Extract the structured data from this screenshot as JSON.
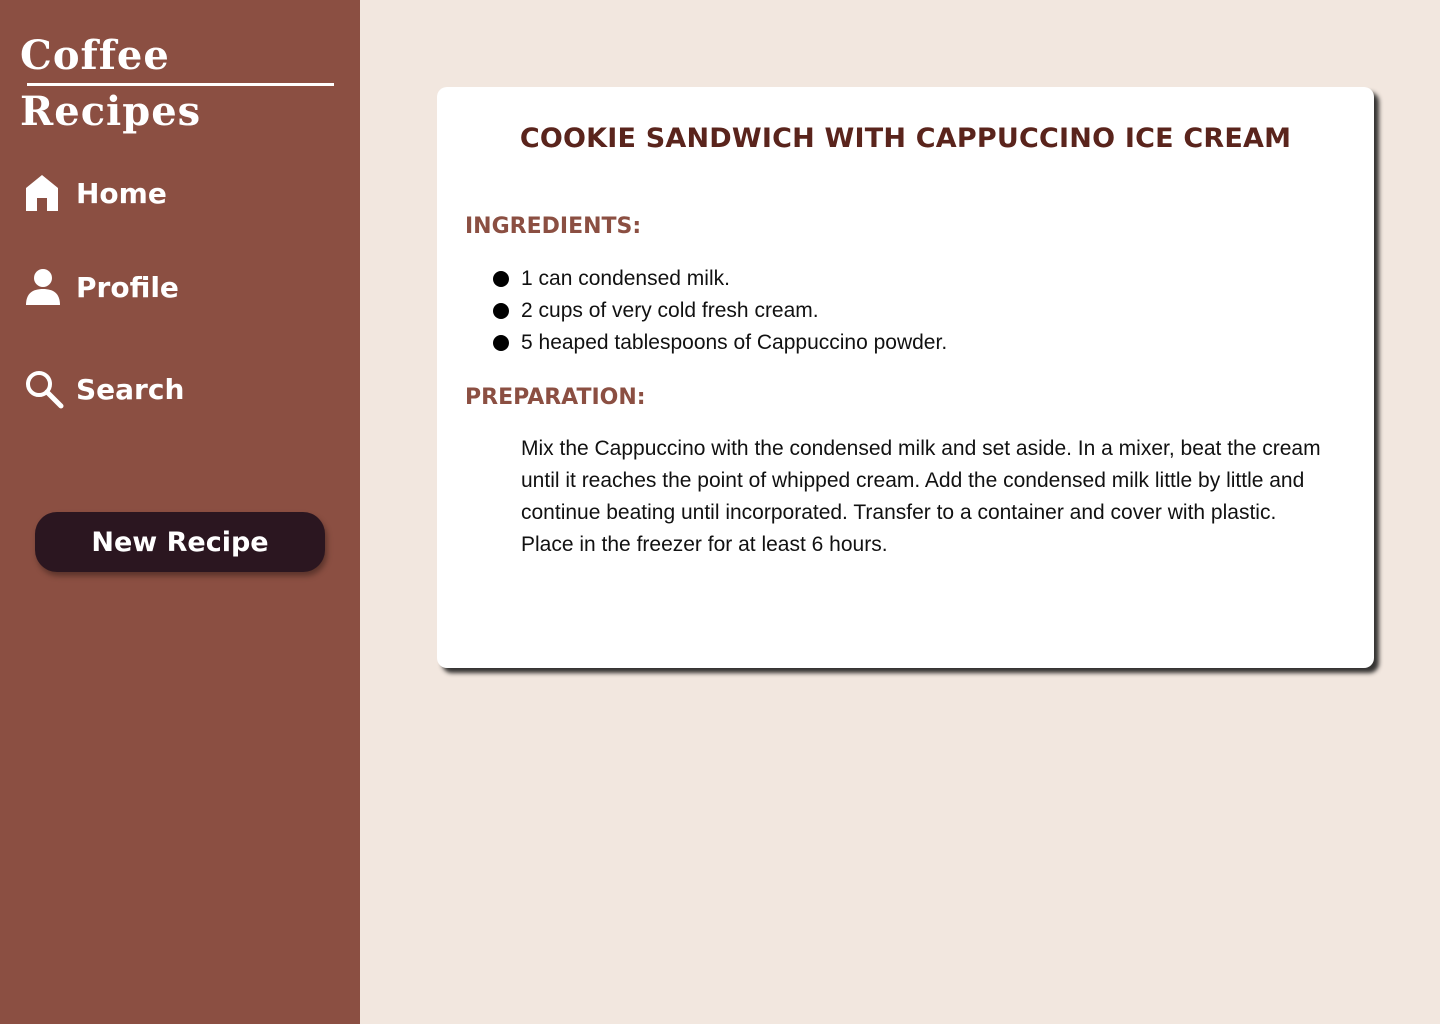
{
  "app": {
    "title": "Coffee Recipes"
  },
  "sidebar": {
    "nav": [
      {
        "label": "Home",
        "icon": "home-icon"
      },
      {
        "label": "Profile",
        "icon": "user-icon"
      },
      {
        "label": "Search",
        "icon": "search-icon"
      }
    ],
    "new_recipe_label": "New Recipe"
  },
  "recipe": {
    "title": "COOKIE SANDWICH WITH CAPPUCCINO ICE CREAM",
    "ingredients_heading": "INGREDIENTS:",
    "ingredients": [
      "1 can condensed milk.",
      "2 cups of very cold fresh cream.",
      "5 heaped tablespoons of Cappuccino powder."
    ],
    "preparation_heading": "PREPARATION:",
    "preparation": "Mix the Cappuccino with the condensed milk and set aside. In a mixer, beat the cream until it reaches the point of whipped cream. Add the condensed milk little by little and continue beating until incorporated. Transfer to a container and cover with plastic. Place in the freezer for at least 6 hours."
  },
  "colors": {
    "sidebar_bg": "#8b4f42",
    "page_bg": "#f2e7df",
    "button_bg": "#2b1620",
    "title_color": "#5a241c",
    "heading_color": "#8b4f42"
  }
}
